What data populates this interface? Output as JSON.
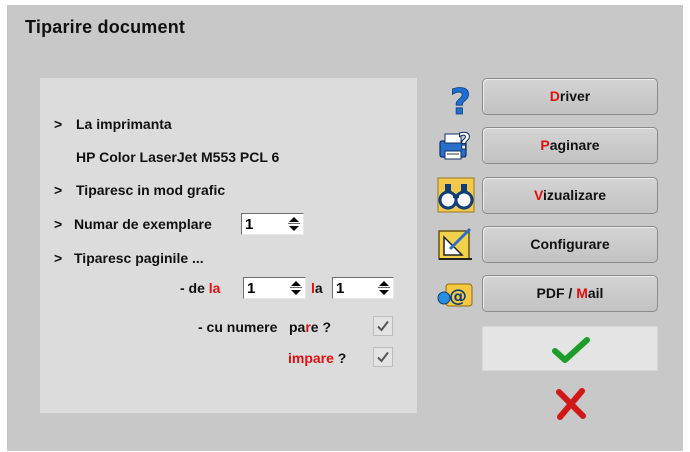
{
  "window": {
    "title": "Tiparire document"
  },
  "printer": {
    "label_arrow": ">",
    "label": "La imprimanta",
    "name": "HP Color LaserJet M553 PCL 6"
  },
  "graphic_mode": {
    "arrow": ">",
    "label": "Tiparesc in mod grafic"
  },
  "copies": {
    "arrow": ">",
    "label": "Numar de exemplare",
    "value": "1"
  },
  "pages": {
    "arrow": ">",
    "label": "Tiparesc paginile ...",
    "from_prefix": "- de ",
    "from_hot": "la",
    "from_value": "1",
    "to_hot": "l",
    "to_rest": "a",
    "to_value": "1",
    "numbers_label": "- cu numere",
    "even_rest_prefix": "pa",
    "even_hot": "r",
    "even_rest": "e ?",
    "even_checked": true,
    "odd_hot": "impare",
    "odd_rest": " ?",
    "odd_checked": true
  },
  "buttons": {
    "driver": {
      "hot": "D",
      "rest": "river"
    },
    "pagination": {
      "hot": "P",
      "rest": "aginare"
    },
    "preview": {
      "hot": "V",
      "rest": "izualizare"
    },
    "configure": {
      "label": "Configurare"
    },
    "pdfmail": {
      "pre": "PDF / ",
      "hot": "M",
      "rest": "ail"
    }
  },
  "colors": {
    "accent_red": "#e01010",
    "check_green": "#1f9d2a",
    "cancel_red": "#d01818"
  },
  "icons": [
    "help-icon",
    "printer-help-icon",
    "binoculars-icon",
    "settings-ruler-icon",
    "email-icon",
    "checkmark-icon",
    "cancel-icon"
  ]
}
